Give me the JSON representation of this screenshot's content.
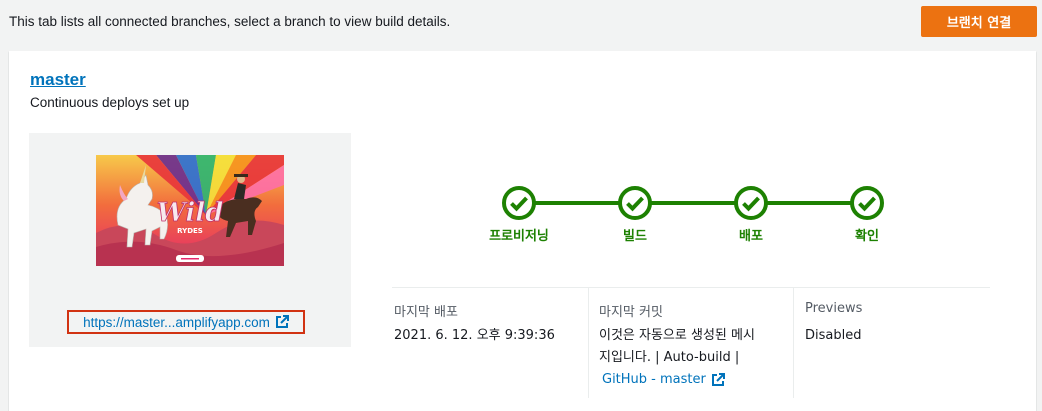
{
  "header": {
    "description": "This tab lists all connected branches, select a branch to view build details.",
    "connect_button_label": "브랜치 연결",
    "accent_color": "#ec7211"
  },
  "branch": {
    "name": "master",
    "status": "Continuous deploys set up",
    "thumbnail_icon": "wild-rydes-preview-image",
    "url_display": "https://master...amplifyapp.com",
    "url_icon": "external-link-icon"
  },
  "pipeline": {
    "color": "#1d8102",
    "steps": [
      {
        "label": "프로비저닝",
        "status": "complete"
      },
      {
        "label": "빌드",
        "status": "complete"
      },
      {
        "label": "배포",
        "status": "complete"
      },
      {
        "label": "확인",
        "status": "complete"
      }
    ]
  },
  "info": {
    "last_deploy": {
      "header": "마지막 배포",
      "value": "2021. 6. 12. 오후 9:39:36"
    },
    "last_commit": {
      "header": "마지막 커밋",
      "line1": "이것은 자동으로 생성된 메시",
      "line2": "지입니다. | Auto-build |",
      "link_text": "GitHub - master"
    },
    "previews": {
      "header": "Previews",
      "value": "Disabled"
    }
  }
}
